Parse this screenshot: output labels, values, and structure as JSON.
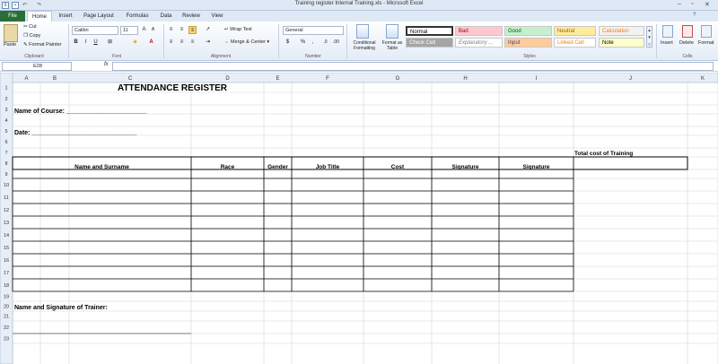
{
  "window": {
    "title": "Training register Internal Training.xls - Microsoft Excel"
  },
  "tabs": [
    {
      "label": "File"
    },
    {
      "label": "Home"
    },
    {
      "label": "Insert"
    },
    {
      "label": "Page Layout"
    },
    {
      "label": "Formulas"
    },
    {
      "label": "Data"
    },
    {
      "label": "Review"
    },
    {
      "label": "View"
    }
  ],
  "ribbon": {
    "clipboard": {
      "paste": "Paste",
      "cut": "Cut",
      "copy": "Copy",
      "format_painter": "Format Painter",
      "group": "Clipboard"
    },
    "font": {
      "name": "Calibri",
      "size": "11",
      "group": "Font",
      "bold": "B",
      "italic": "I",
      "underline": "U"
    },
    "alignment": {
      "wrap": "Wrap Text",
      "merge": "Merge & Center",
      "group": "Alignment"
    },
    "number": {
      "format": "General",
      "group": "Number",
      "currency": "$",
      "percent": "%",
      "comma": ","
    },
    "styles": {
      "conditional": "Conditional Formatting",
      "format_table": "Format as Table",
      "group": "Styles",
      "cells": [
        {
          "label": "Normal",
          "bg": "#ffffff",
          "fg": "#000000"
        },
        {
          "label": "Bad",
          "bg": "#ffc7ce",
          "fg": "#9c0006"
        },
        {
          "label": "Good",
          "bg": "#c6efce",
          "fg": "#006100"
        },
        {
          "label": "Neutral",
          "bg": "#ffeb9c",
          "fg": "#9c6500"
        },
        {
          "label": "Calculation",
          "bg": "#f2f2f2",
          "fg": "#fa7d00"
        },
        {
          "label": "Check Cell",
          "bg": "#a5a5a5",
          "fg": "#ffffff"
        },
        {
          "label": "Explanatory ...",
          "bg": "#ffffff",
          "fg": "#7f7f7f"
        },
        {
          "label": "Input",
          "bg": "#ffcc99",
          "fg": "#3f3f76"
        },
        {
          "label": "Linked Cell",
          "bg": "#ffffff",
          "fg": "#fa7d00"
        },
        {
          "label": "Note",
          "bg": "#ffffcc",
          "fg": "#000000"
        }
      ]
    },
    "cells": {
      "insert": "Insert",
      "delete": "Delete",
      "format": "Format",
      "group": "Cells"
    }
  },
  "formula_bar": {
    "name_box": "E28",
    "fx": "fx",
    "value": ""
  },
  "columns": [
    "A",
    "B",
    "C",
    "D",
    "E",
    "F",
    "G",
    "H",
    "I",
    "J",
    "K"
  ],
  "rows": [
    "1",
    "2",
    "3",
    "4",
    "5",
    "6",
    "7",
    "8",
    "9",
    "10",
    "11",
    "12",
    "13",
    "14",
    "15",
    "16",
    "17",
    "18",
    "19",
    "20",
    "21",
    "22",
    "23"
  ],
  "sheet": {
    "title": "ATTENDANCE REGISTER",
    "name_of_course": "Name of Course: _______________________",
    "date": "Date:  ______________________________",
    "total_cost": "Total cost of Training",
    "headers": [
      "Name and Surname",
      "Race",
      "Gender",
      "Job Title",
      "Cost",
      "Signature",
      "Signature"
    ],
    "trainer": "Name and Signature of Trainer:"
  },
  "colors": {
    "accent": "#2a6e37",
    "ribbon_border": "#b6c8e0",
    "header_bg": "#e8eef7"
  }
}
